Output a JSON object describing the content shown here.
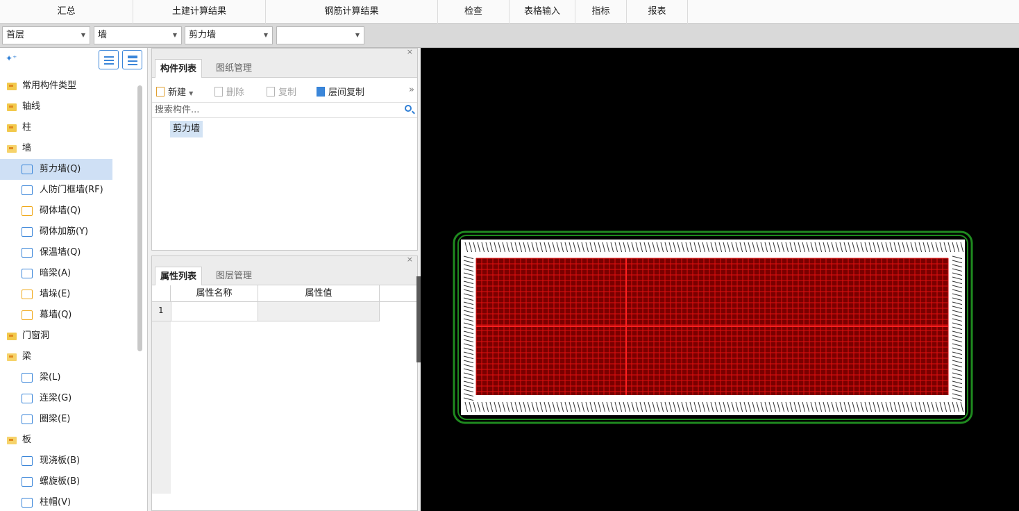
{
  "menu": {
    "items": [
      "汇总",
      "土建计算结果",
      "钢筋计算结果",
      "检查",
      "表格输入",
      "指标",
      "报表"
    ]
  },
  "selectors": {
    "floor": "首层",
    "category": "墙",
    "type": "剪力墙",
    "extra": ""
  },
  "tree": {
    "items": [
      {
        "label": "常用构件类型",
        "level": 1,
        "icon": "folder-icon"
      },
      {
        "label": "轴线",
        "level": 1,
        "icon": "folder-icon"
      },
      {
        "label": "柱",
        "level": 1,
        "icon": "folder-icon"
      },
      {
        "label": "墙",
        "level": 1,
        "icon": "folder-open-icon"
      },
      {
        "label": "剪力墙(Q)",
        "level": 2,
        "icon": "shear-wall-icon",
        "selected": true
      },
      {
        "label": "人防门框墙(RF)",
        "level": 2,
        "icon": "door-frame-wall-icon"
      },
      {
        "label": "砌体墙(Q)",
        "level": 2,
        "icon": "masonry-wall-icon"
      },
      {
        "label": "砌体加筋(Y)",
        "level": 2,
        "icon": "masonry-rebar-icon"
      },
      {
        "label": "保温墙(Q)",
        "level": 2,
        "icon": "insulation-wall-icon"
      },
      {
        "label": "暗梁(A)",
        "level": 2,
        "icon": "hidden-beam-icon"
      },
      {
        "label": "墙垛(E)",
        "level": 2,
        "icon": "wall-pier-icon"
      },
      {
        "label": "幕墙(Q)",
        "level": 2,
        "icon": "curtain-wall-icon"
      },
      {
        "label": "门窗洞",
        "level": 1,
        "icon": "folder-icon"
      },
      {
        "label": "梁",
        "level": 1,
        "icon": "folder-open-icon"
      },
      {
        "label": "梁(L)",
        "level": 2,
        "icon": "beam-icon"
      },
      {
        "label": "连梁(G)",
        "level": 2,
        "icon": "coupling-beam-icon"
      },
      {
        "label": "圈梁(E)",
        "level": 2,
        "icon": "ring-beam-icon"
      },
      {
        "label": "板",
        "level": 1,
        "icon": "folder-open-icon"
      },
      {
        "label": "现浇板(B)",
        "level": 2,
        "icon": "cast-slab-icon"
      },
      {
        "label": "螺旋板(B)",
        "level": 2,
        "icon": "spiral-slab-icon"
      },
      {
        "label": "柱帽(V)",
        "level": 2,
        "icon": "column-cap-icon"
      }
    ]
  },
  "component_panel": {
    "tabs": [
      "构件列表",
      "图纸管理"
    ],
    "close": "×",
    "toolbar": {
      "new": "新建",
      "delete": "删除",
      "copy": "复制",
      "floor_copy": "层间复制",
      "more": "»"
    },
    "search_placeholder": "搜索构件...",
    "items": [
      "剪力墙"
    ]
  },
  "property_panel": {
    "tabs": [
      "属性列表",
      "图层管理"
    ],
    "close": "×",
    "columns": [
      "属性名称",
      "属性值"
    ],
    "rows": [
      "1"
    ]
  },
  "canvas": {
    "background": "#000000",
    "grid_color": "#e01010",
    "fill_color": "#7a0000",
    "label_color": "#ffffff",
    "outline_color": "#1f8a1f"
  }
}
